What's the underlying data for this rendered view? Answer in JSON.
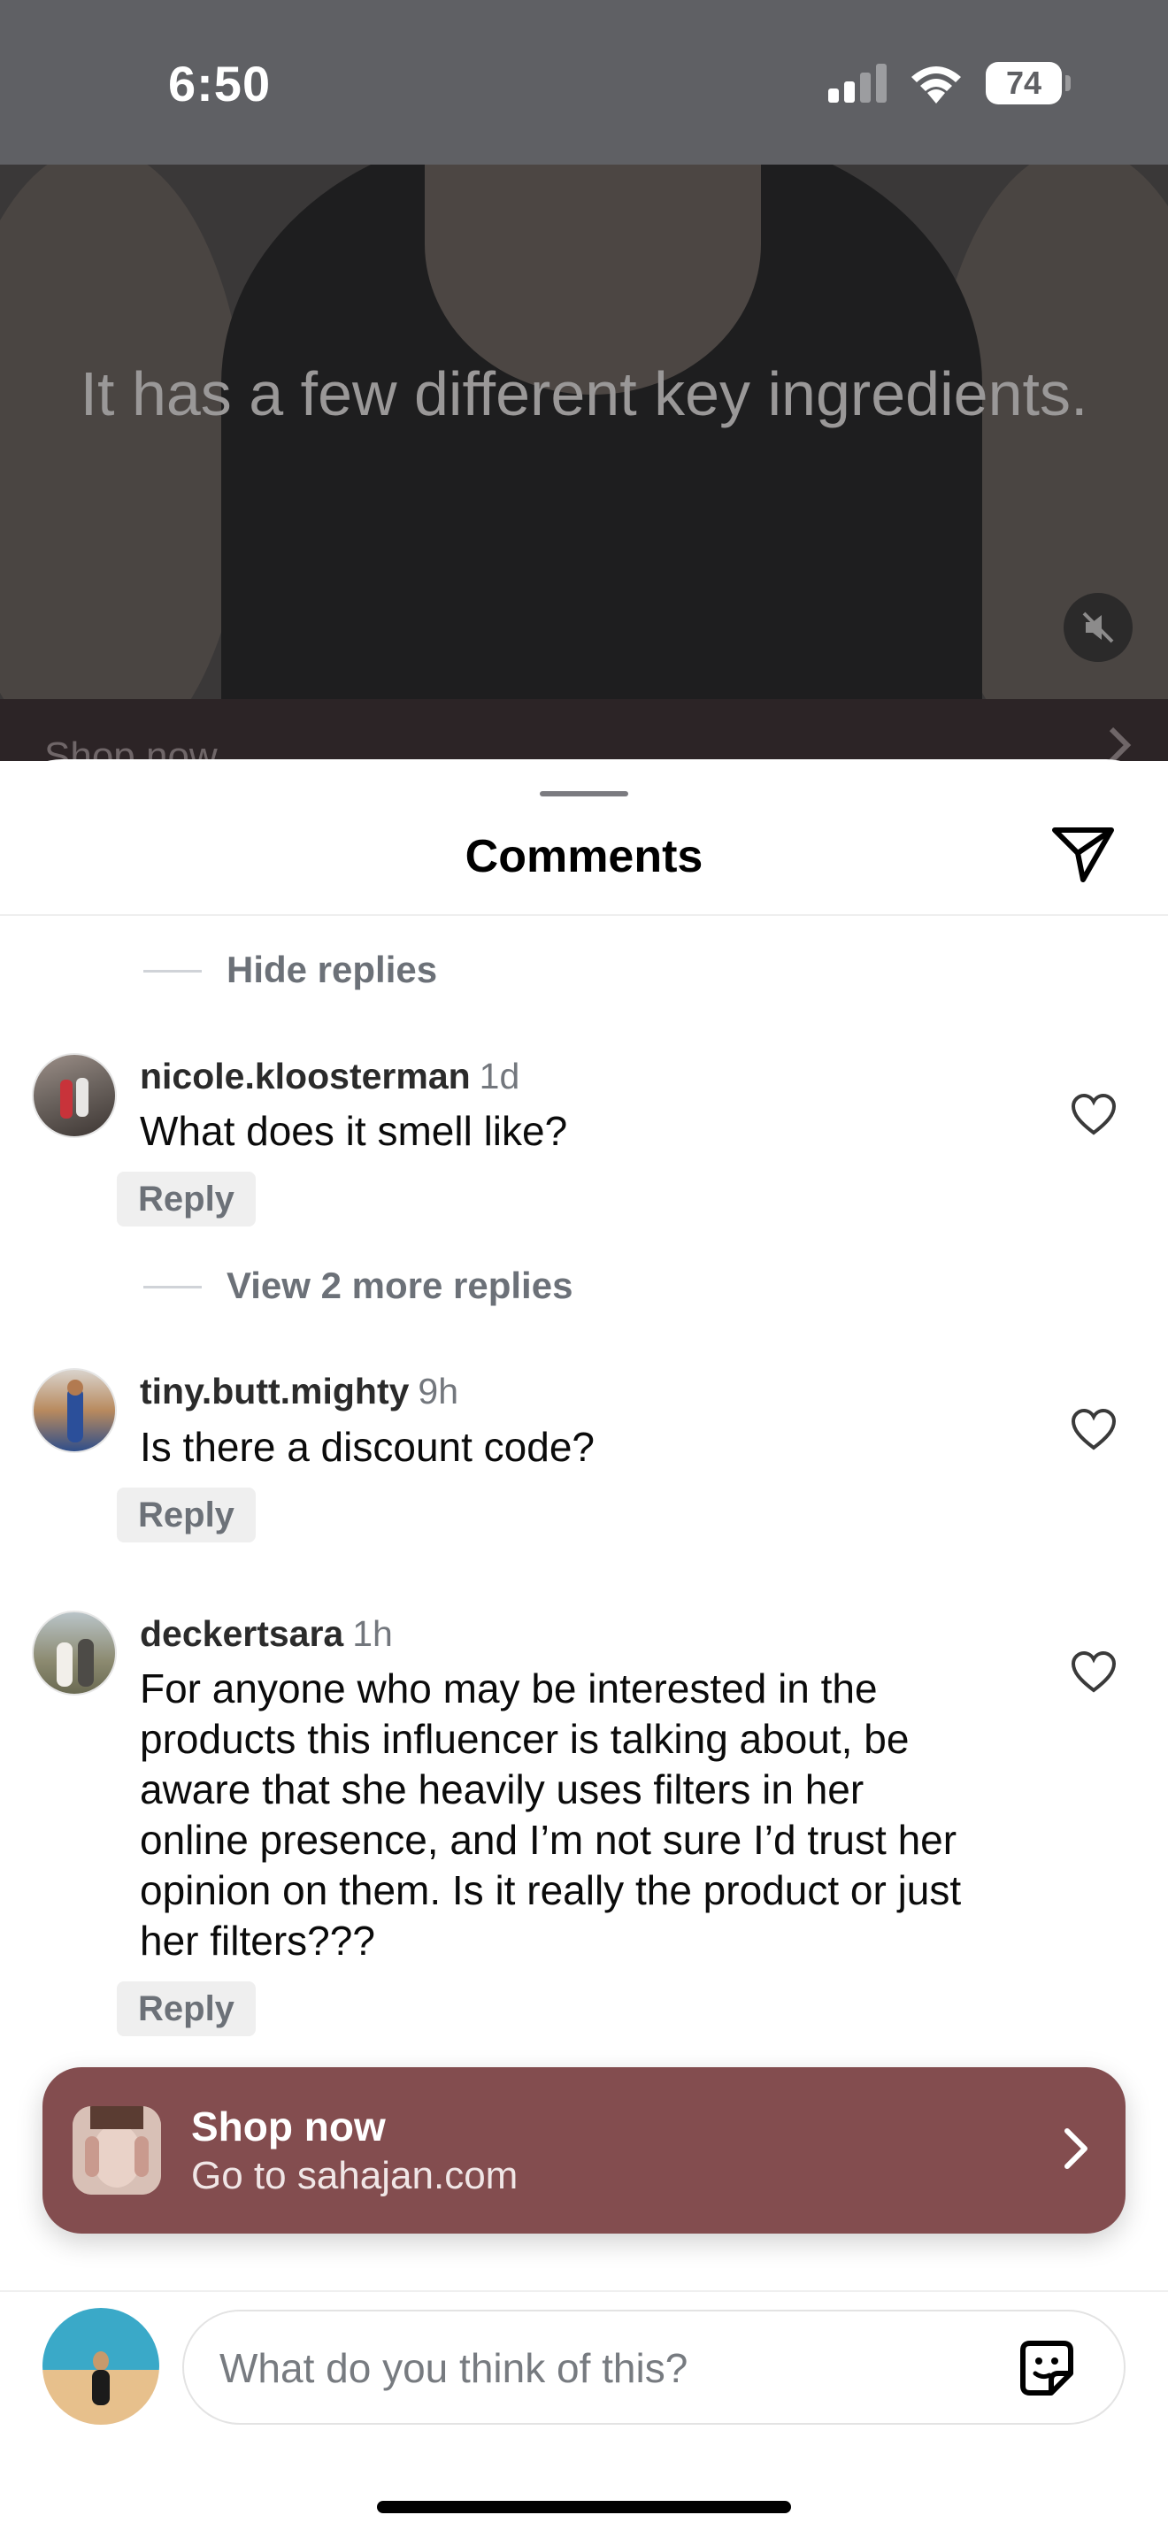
{
  "status_bar": {
    "time": "6:50",
    "battery": "74"
  },
  "video": {
    "caption": "It has a few different key ingredients.",
    "shop_label": "Shop now"
  },
  "sheet": {
    "title": "Comments"
  },
  "threads": {
    "hide_replies": "Hide replies",
    "view_more": "View 2 more replies"
  },
  "comments": [
    {
      "username": "nicole.kloosterman",
      "time": "1d",
      "text": "What does it smell like?",
      "reply": "Reply"
    },
    {
      "username": "tiny.butt.mighty",
      "time": "9h",
      "text": "Is there a discount code?",
      "reply": "Reply"
    },
    {
      "username": "deckertsara",
      "time": "1h",
      "lines": [
        "For anyone who may be interested in the",
        "products this influencer is talking about, be",
        "aware that she heavily uses filters in her",
        "online presence, and I’m not sure I’d trust her",
        "opinion on them. Is it really the product or just",
        "her filters???"
      ],
      "reply": "Reply"
    }
  ],
  "shop_card": {
    "title": "Shop now",
    "subtitle": "Go to sahajan.com",
    "accent": "#834d4f"
  },
  "composer": {
    "placeholder": "What do you think of this?"
  },
  "icons": [
    "signal-icon",
    "wifi-icon",
    "battery-icon",
    "mute-icon",
    "send-icon",
    "heart-icon",
    "chevron-right-icon",
    "sticker-icon"
  ]
}
